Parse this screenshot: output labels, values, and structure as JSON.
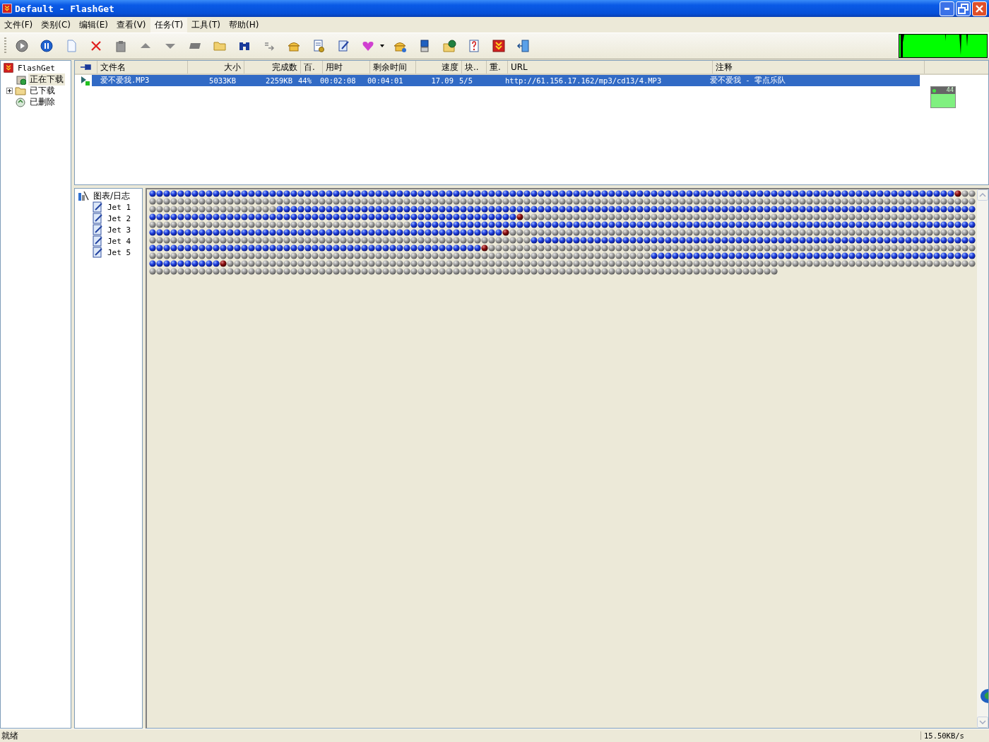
{
  "window": {
    "title": "Default - FlashGet"
  },
  "menu": [
    {
      "label": "文件(F)",
      "selected": false
    },
    {
      "label": "类别(C)",
      "selected": false
    },
    {
      "label": "编辑(E)",
      "selected": false
    },
    {
      "label": "查看(V)",
      "selected": false
    },
    {
      "label": "任务(T)",
      "selected": true
    },
    {
      "label": "工具(T)",
      "selected": false
    },
    {
      "label": "帮助(H)",
      "selected": false
    }
  ],
  "category_tree": {
    "label": "FlashGet",
    "children": [
      {
        "label": "正在下载",
        "kind": "downloading",
        "selected": true,
        "expandable": false
      },
      {
        "label": "已下载",
        "kind": "downloaded",
        "selected": false,
        "expandable": true,
        "expanded": false
      },
      {
        "label": "已删除",
        "kind": "deleted",
        "selected": false,
        "expandable": false
      }
    ]
  },
  "task_list": {
    "columns": [
      "文件名",
      "大小",
      "完成数",
      "百.",
      "用时",
      "剩余时间",
      "速度",
      "块..",
      "重.",
      "URL",
      "注释"
    ],
    "rows": [
      {
        "selected": true,
        "kind": "running",
        "file_name": "爱不爱我.MP3",
        "size": "5033KB",
        "done": "2259KB",
        "percent": "44%",
        "elapsed": "00:02:08",
        "remaining": "00:04:01",
        "speed": "17.09",
        "blocks": "5/5",
        "url": "http://61.156.17.162/mp3/cd13/4.MP3",
        "comment": "爱不爱我 - 零点乐队"
      }
    ]
  },
  "drop_window": {
    "percent": "44"
  },
  "detail_tree": {
    "label": "图表/日志",
    "children": [
      {
        "label": "Jet 1"
      },
      {
        "label": "Jet 2"
      },
      {
        "label": "Jet 3"
      },
      {
        "label": "Jet 4"
      },
      {
        "label": "Jet 5"
      }
    ]
  },
  "status_bar": {
    "message": "就绪",
    "speed": "15.50KB/s"
  }
}
